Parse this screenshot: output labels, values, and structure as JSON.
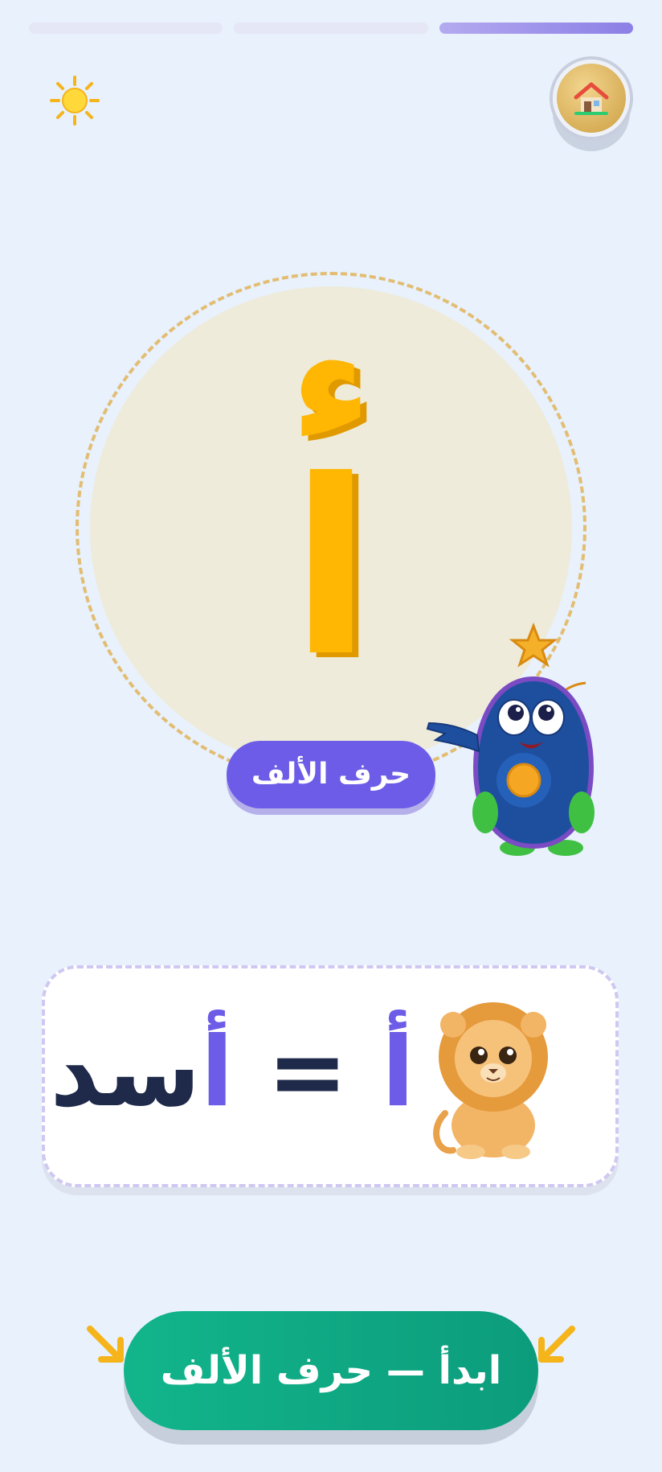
{
  "progress": {
    "segments": 3,
    "active_index": 2
  },
  "header": {
    "home_icon": "home-icon",
    "theme_icon": "sun-icon"
  },
  "letter_card": {
    "hamza": "ء",
    "letter": "ا",
    "label": "حرف الألف"
  },
  "word_example": {
    "letter": "أ",
    "equals": "=",
    "word_first": "أ",
    "word_rest": "سد"
  },
  "start_button": {
    "label": "ابدأ — حرف الألف"
  },
  "colors": {
    "accent": "#6c5ce7",
    "letter": "#ffb703",
    "primary_button": "#12b58b",
    "background": "#e8f1fc"
  }
}
